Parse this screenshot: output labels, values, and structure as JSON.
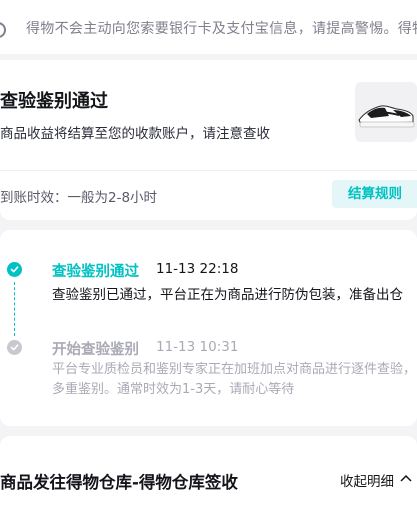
{
  "notice": {
    "text": "得物不会主动向您索要银行卡及支付宝信息，请提高警惕。得物始终"
  },
  "status_card": {
    "title": "查验鉴别通过",
    "subtitle": "商品收益将结算至您的收款账户，请注意查收",
    "eta_label": "到账时效：",
    "eta_value": "一般为2-8小时",
    "settle_button": "结算规则"
  },
  "timeline": {
    "steps": [
      {
        "title": "查验鉴别通过",
        "time": "11-13 22:18",
        "desc": "查验鉴别已通过，平台正在为商品进行防伪包装，准备出仓",
        "state": "active"
      },
      {
        "title": "开始查验鉴别",
        "time": "11-13 10:31",
        "desc": "平台专业质检员和鉴别专家正在加班加点对商品进行逐件查验，多重鉴别。通常时效为1-3天，请耐心等待",
        "state": "done"
      }
    ]
  },
  "shipping": {
    "title": "商品发往得物仓库-得物仓库签收",
    "collapse_label": "收起明细"
  },
  "colors": {
    "accent": "#01c2c3",
    "text": "#14151a",
    "muted": "#aaaab6"
  }
}
